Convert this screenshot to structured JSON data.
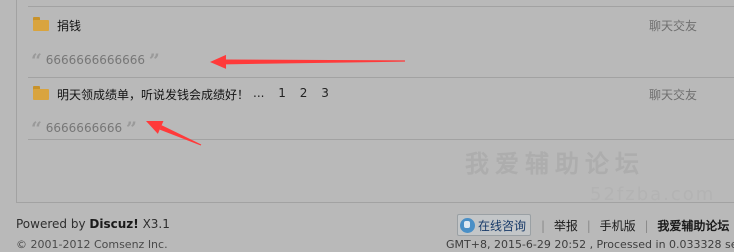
{
  "threads": [
    {
      "title": "捐钱",
      "forum": "聊天交友",
      "reply": "6666666666666"
    },
    {
      "title": "明天领成绩单，听说发钱会成绩好！",
      "forum": "聊天交友",
      "reply": "6666666666",
      "pages": [
        "...",
        "1",
        "2",
        "3"
      ]
    }
  ],
  "quote_open": "“",
  "quote_close": "”",
  "watermark": {
    "line1": "我爱辅助论坛",
    "line2": "52fzba.com"
  },
  "footer": {
    "powered_prefix": "Powered by",
    "powered_brand": "Discuz!",
    "powered_version": "X3.1",
    "copyright": "© 2001-2012 Comsenz Inc.",
    "online_button": "在线咨询",
    "links": [
      "举报",
      "手机版",
      "我爱辅助论坛（"
    ],
    "time_info": "GMT+8, 2015-6-29 20:52 , Processed in 0.033328 se"
  },
  "colors": {
    "annotation_arrow": "#ff3a3a",
    "folder_icon": "#d9a43e"
  }
}
